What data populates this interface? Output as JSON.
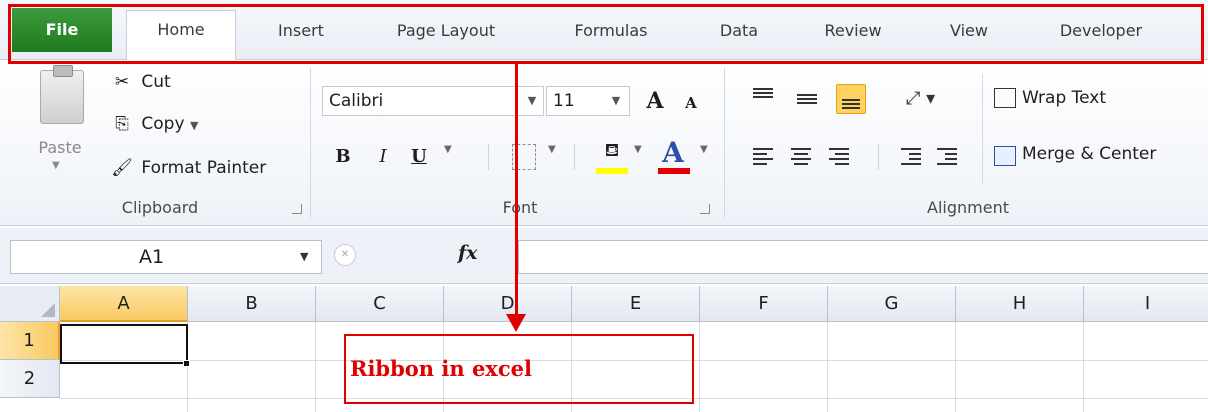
{
  "tabs": {
    "file": "File",
    "home": "Home",
    "insert": "Insert",
    "page_layout": "Page Layout",
    "formulas": "Formulas",
    "data": "Data",
    "review": "Review",
    "view": "View",
    "developer": "Developer"
  },
  "clipboard": {
    "paste": "Paste",
    "cut": "Cut",
    "copy": "Copy",
    "format_painter": "Format Painter",
    "label": "Clipboard"
  },
  "font": {
    "name": "Calibri",
    "size": "11",
    "bold": "B",
    "italic": "I",
    "underline": "U",
    "font_color": "A",
    "grow": "A",
    "shrink": "A",
    "label": "Font"
  },
  "alignment": {
    "wrap_text": "Wrap Text",
    "merge_center": "Merge & Center",
    "label": "Alignment"
  },
  "formula_bar": {
    "name_box": "A1",
    "fx": "fx"
  },
  "grid": {
    "columns": [
      "A",
      "B",
      "C",
      "D",
      "E",
      "F",
      "G",
      "H",
      "I"
    ],
    "rows": [
      "1",
      "2"
    ]
  },
  "annotation": {
    "text": "Ribbon in excel",
    "color": "#e00000"
  },
  "colors": {
    "file_tab": "#1e7a1e",
    "selection": "#ffd25e",
    "fill_color": "#ffff00",
    "font_color": "#e00000"
  }
}
